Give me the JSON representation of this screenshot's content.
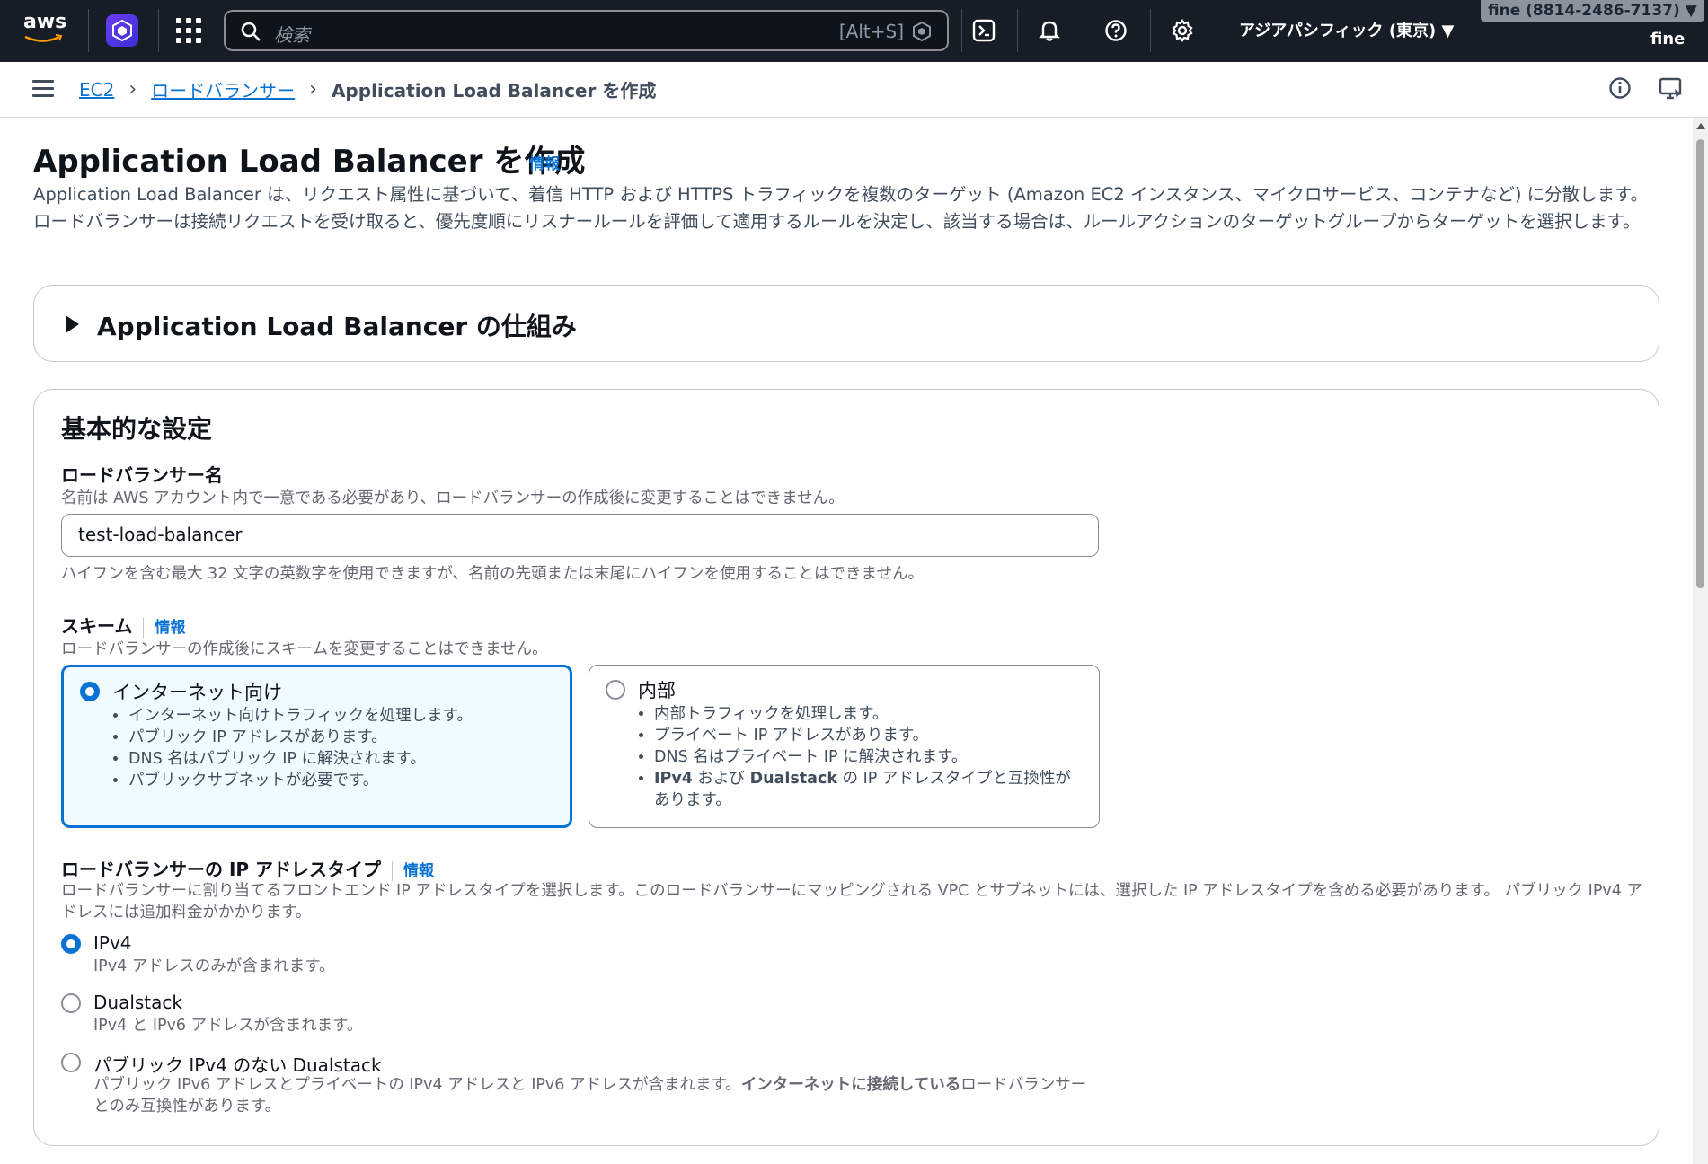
{
  "topnav": {
    "logo": "aws",
    "search_placeholder": "検索",
    "search_shortcut": "[Alt+S]",
    "region": "アジアパシフィック (東京) ▼",
    "account": "fine (8814-2486-7137) ▼",
    "user": "fine"
  },
  "breadcrumb": {
    "items": [
      "EC2",
      "ロードバランサー"
    ],
    "current": "Application Load Balancer を作成"
  },
  "page": {
    "title": "Application Load Balancer を作成",
    "info": "情報",
    "description": "Application Load Balancer は、リクエスト属性に基づいて、着信 HTTP および HTTPS トラフィックを複数のターゲット (Amazon EC2 インスタンス、マイクロサービス、コンテナなど) に分散します。ロードバランサーは接続リクエストを受け取ると、優先度順にリスナールールを評価して適用するルールを決定し、該当する場合は、ルールアクションのターゲットグループからターゲットを選択します。"
  },
  "how_it_works": {
    "title": "Application Load Balancer の仕組み"
  },
  "basic": {
    "title": "基本的な設定",
    "name_label": "ロードバランサー名",
    "name_desc": "名前は AWS アカウント内で一意である必要があり、ロードバランサーの作成後に変更することはできません。",
    "name_value": "test-load-balancer",
    "name_hint": "ハイフンを含む最大 32 文字の英数字を使用できますが、名前の先頭または末尾にハイフンを使用することはできません。",
    "scheme_label": "スキーム",
    "scheme_info": "情報",
    "scheme_desc": "ロードバランサーの作成後にスキームを変更することはできません。",
    "scheme_options": [
      {
        "title": "インターネット向け",
        "selected": true,
        "bullets": [
          "インターネット向けトラフィックを処理します。",
          "パブリック IP アドレスがあります。",
          "DNS 名はパブリック IP に解決されます。",
          "パブリックサブネットが必要です。"
        ]
      },
      {
        "title": "内部",
        "selected": false,
        "bullets": [
          "内部トラフィックを処理します。",
          "プライベート IP アドレスがあります。",
          "DNS 名はプライベート IP に解決されます。"
        ],
        "bullet4_bold1": "IPv4",
        "bullet4_mid": " および ",
        "bullet4_bold2": "Dualstack",
        "bullet4_rest": " の IP アドレスタイプと互換性があります。"
      }
    ],
    "ip_label": "ロードバランサーの IP アドレスタイプ",
    "ip_info": "情報",
    "ip_desc": "ロードバランサーに割り当てるフロントエンド IP アドレスタイプを選択します。このロードバランサーにマッピングされる VPC とサブネットには、選択した IP アドレスタイプを含める必要があります。 パブリック IPv4 アドレスには追加料金がかかります。",
    "ip_options": [
      {
        "title": "IPv4",
        "desc": "IPv4 アドレスのみが含まれます。",
        "selected": true
      },
      {
        "title": "Dualstack",
        "desc": "IPv4 と IPv6 アドレスが含まれます。",
        "selected": false
      },
      {
        "title": "パブリック IPv4 のない Dualstack",
        "desc_a": "パブリック IPv6 アドレスとプライベートの IPv4 アドレスと IPv6 アドレスが含まれます。",
        "desc_bold": "インターネットに接続している",
        "desc_b": "ロードバランサーとのみ互換性があります。",
        "selected": false
      }
    ]
  },
  "colors": {
    "nav_bg": "#161d26",
    "link": "#0972d3",
    "selected_tile_bg": "#f0fbff"
  }
}
